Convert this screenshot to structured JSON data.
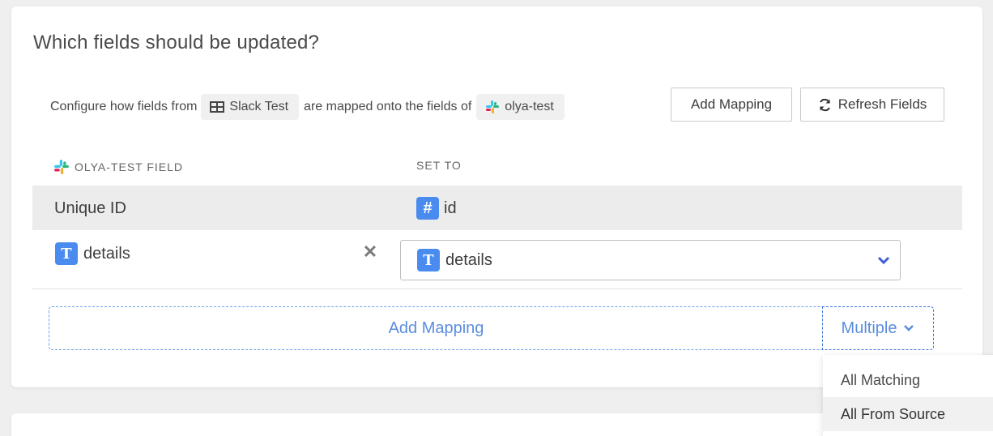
{
  "section": {
    "title": "Which fields should be updated?",
    "config_prefix": "Configure how fields from",
    "source_chip": "Slack Test",
    "config_middle": "are mapped onto the fields of",
    "target_chip": "olya-test"
  },
  "buttons": {
    "add_mapping": "Add Mapping",
    "refresh_fields": "Refresh Fields"
  },
  "columns": {
    "left": "OLYA-TEST FIELD",
    "right": "SET TO"
  },
  "rows": [
    {
      "field": "Unique ID",
      "value": "id",
      "value_icon": "#"
    },
    {
      "field": "details",
      "field_icon": "T",
      "value": "details",
      "value_icon": "T"
    }
  ],
  "footer": {
    "add_mapping": "Add Mapping",
    "multiple": "Multiple"
  },
  "dropdown": {
    "items": [
      "All Matching",
      "All From Source"
    ]
  },
  "colors": {
    "accent": "#4a8bf0",
    "link": "#5a8de0"
  }
}
